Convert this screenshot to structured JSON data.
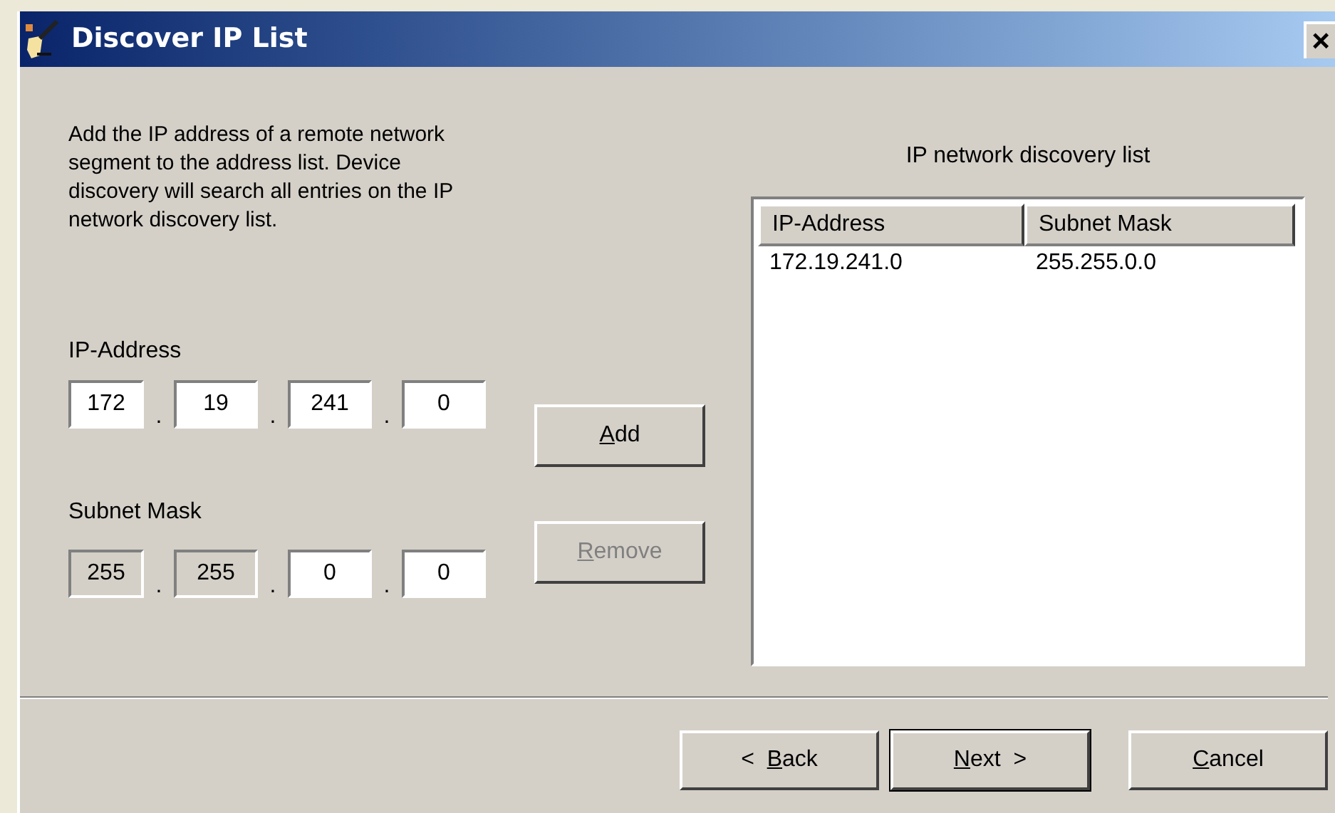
{
  "window": {
    "title": "Discover IP List",
    "close": "×"
  },
  "description": "Add the IP address of a remote network segment to the address list. Device discovery will search all entries on the IP network discovery list.",
  "ip_address": {
    "label": "IP-Address",
    "octets": [
      {
        "value": "172",
        "disabled": false
      },
      {
        "value": "19",
        "disabled": false
      },
      {
        "value": "241",
        "disabled": false
      },
      {
        "value": "0",
        "disabled": false
      }
    ]
  },
  "subnet_mask": {
    "label": "Subnet Mask",
    "octets": [
      {
        "value": "255",
        "disabled": true
      },
      {
        "value": "255",
        "disabled": true
      },
      {
        "value": "0",
        "disabled": false
      },
      {
        "value": "0",
        "disabled": false
      }
    ]
  },
  "separator": ".",
  "add_button": {
    "label": {
      "key": "A",
      "after": "dd"
    },
    "disabled": false
  },
  "remove_button": {
    "label": {
      "key": "R",
      "after": "emove"
    },
    "disabled": true
  },
  "list": {
    "title": "IP network discovery list",
    "columns": [
      "IP-Address",
      "Subnet Mask"
    ],
    "rows": [
      [
        "172.19.241.0",
        "255.255.0.0"
      ]
    ]
  },
  "buttons": [
    {
      "label": {
        "before": "<  ",
        "key": "B",
        "after": "ack"
      },
      "default": false
    },
    {
      "label": {
        "key": "N",
        "after": "ext  >"
      },
      "default": true
    },
    {
      "label": {
        "key": "C",
        "after": "ancel"
      },
      "default": false
    }
  ]
}
